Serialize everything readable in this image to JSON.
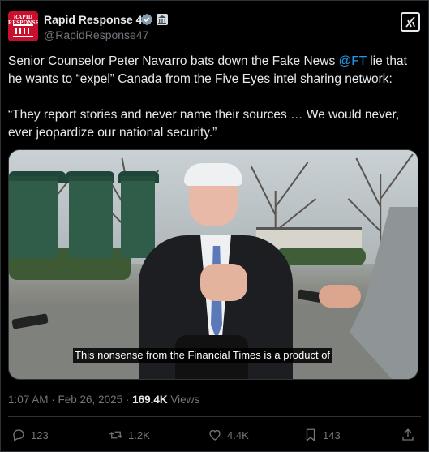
{
  "author": {
    "display_name": "Rapid Response 47",
    "handle": "@RapidResponse47",
    "avatar_text": "RAPID RESPONSE",
    "verified_icon": "verified-badge-icon",
    "affiliation_icon": "white-house-icon"
  },
  "header": {
    "grok_button": "grok-icon"
  },
  "tweet": {
    "text_before_mention": "Senior Counselor Peter Navarro bats down the Fake News ",
    "mention": "@FT",
    "text_after_mention": " lie that he wants to “expel” Canada from the Five Eyes intel sharing network:",
    "quote": "“They report stories and never name their sources … We would never, ever jeopardize our national security.”"
  },
  "media": {
    "caption": "This nonsense from the Financial Times is a product of"
  },
  "meta": {
    "time": "1:07 AM",
    "separator": " · ",
    "date": "Feb 26, 2025",
    "views_count": "169.4K",
    "views_label": " Views"
  },
  "actions": {
    "reply_count": "123",
    "retweet_count": "1.2K",
    "like_count": "4.4K",
    "bookmark_count": "143"
  },
  "colors": {
    "background": "#000000",
    "text": "#e7e9ea",
    "muted": "#71767b",
    "accent": "#1d9bf0"
  }
}
